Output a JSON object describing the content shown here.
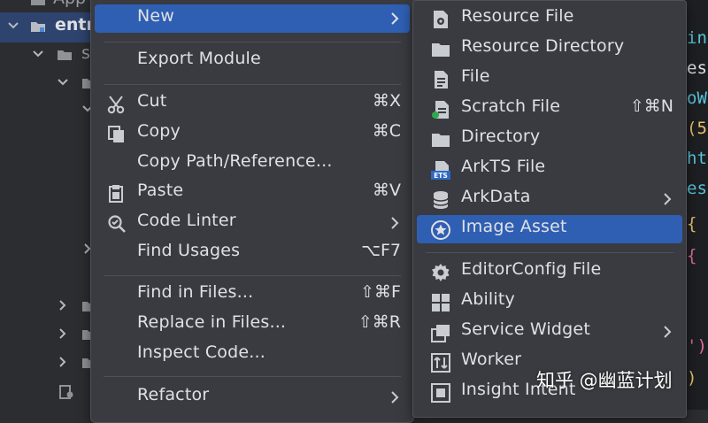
{
  "tree": {
    "rows": [
      {
        "text": "App"
      },
      {
        "text": "entr"
      },
      {
        "text": "s"
      }
    ]
  },
  "editor": {
    "lines": [
      "in",
      "es",
      "oW",
      "(5",
      "ht",
      "es",
      " {",
      " {",
      "",
      "",
      "",
      "')",
      ")"
    ]
  },
  "main_menu": {
    "new": {
      "label": "New"
    },
    "export_module": {
      "label": "Export Module"
    },
    "cut": {
      "label": "Cut",
      "shortcut": "⌘X"
    },
    "copy": {
      "label": "Copy",
      "shortcut": "⌘C"
    },
    "copy_path": {
      "label": "Copy Path/Reference..."
    },
    "paste": {
      "label": "Paste",
      "shortcut": "⌘V"
    },
    "code_linter": {
      "label": "Code Linter"
    },
    "find_usages": {
      "label": "Find Usages",
      "shortcut": "⌥F7"
    },
    "find_in_files": {
      "label": "Find in Files...",
      "shortcut": "⇧⌘F"
    },
    "replace_in_files": {
      "label": "Replace in Files...",
      "shortcut": "⇧⌘R"
    },
    "inspect_code": {
      "label": "Inspect Code..."
    },
    "refactor": {
      "label": "Refactor"
    }
  },
  "sub_menu": {
    "resource_file": {
      "label": "Resource File",
      "icon": "resource-file-icon"
    },
    "resource_directory": {
      "label": "Resource Directory",
      "icon": "folder-icon"
    },
    "file": {
      "label": "File",
      "icon": "file-icon"
    },
    "scratch_file": {
      "label": "Scratch File",
      "shortcut": "⇧⌘N",
      "icon": "scratch-file-icon"
    },
    "directory": {
      "label": "Directory",
      "icon": "folder-icon"
    },
    "arkts_file": {
      "label": "ArkTS File",
      "icon": "ets-file-icon",
      "icon_text": "ETS"
    },
    "arkdata": {
      "label": "ArkData",
      "icon": "database-icon"
    },
    "image_asset": {
      "label": "Image Asset",
      "icon": "star-circle-icon"
    },
    "editorconfig_file": {
      "label": "EditorConfig File",
      "icon": "gear-icon"
    },
    "ability": {
      "label": "Ability",
      "icon": "grid-icon"
    },
    "service_widget": {
      "label": "Service Widget",
      "icon": "widget-icon"
    },
    "worker": {
      "label": "Worker",
      "icon": "worker-icon"
    },
    "insight_intent": {
      "label": "Insight Intent",
      "icon": "cube-icon"
    }
  },
  "watermark": {
    "text": "知乎 @幽蓝计划"
  },
  "colors": {
    "menu_bg": "#393b40",
    "highlight": "#2f5fb3",
    "tree_selected": "#2e436e",
    "text": "#dfe1e5",
    "editor_cyan": "#56c4d9",
    "editor_yellow": "#e8c46a",
    "editor_pink": "#e06c9f"
  }
}
